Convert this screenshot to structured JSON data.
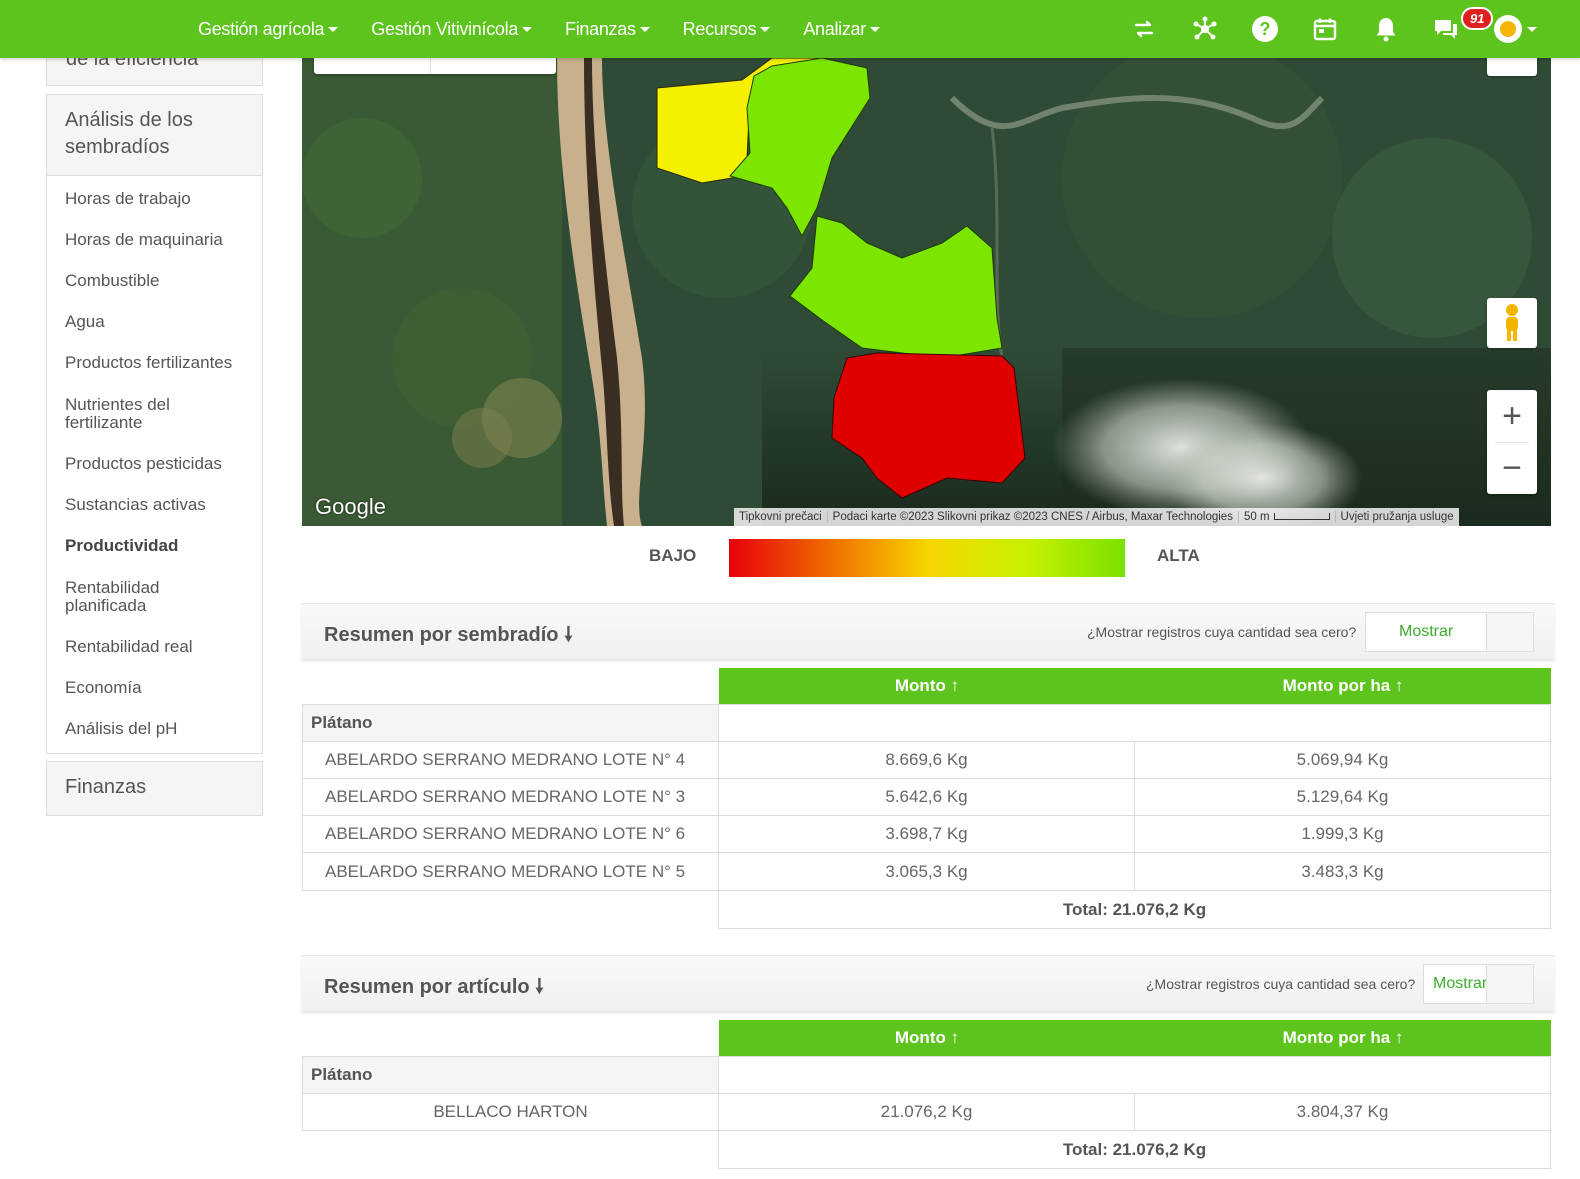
{
  "nav": {
    "menu": [
      "Gestión agrícola",
      "Gestión Vitivinícola",
      "Finanzas",
      "Recursos",
      "Analizar"
    ],
    "notifications_badge": "91",
    "icons": [
      "swap-icon",
      "network-icon",
      "help-icon",
      "calendar-icon",
      "bell-icon",
      "chat-icon"
    ]
  },
  "sidebar": {
    "top_partial": "de la eficiencia",
    "section_title": "Análisis de los sembradíos",
    "items": [
      "Horas de trabajo",
      "Horas de maquinaria",
      "Combustible",
      "Agua",
      "Productos fertilizantes",
      "Nutrientes del fertilizante",
      "Productos pesticidas",
      "Sustancias activas",
      "Productividad",
      "Rentabilidad planificada",
      "Rentabilidad real",
      "Economía",
      "Análisis del pH"
    ],
    "active_item": "Productividad",
    "finanzas": "Finanzas"
  },
  "map": {
    "google_logo": "Google",
    "attribution": [
      "Tipkovni prečaci",
      "Podaci karte ©2023 Slikovni prikaz ©2023 CNES / Airbus, Maxar Technologies",
      "50 m",
      "Uvjeti pružanja usluge"
    ],
    "zoom_in": "+",
    "zoom_out": "−"
  },
  "legend": {
    "low": "BAJO",
    "high": "ALTA",
    "low_color": "#e8000b",
    "high_color": "#7ae200"
  },
  "summary_field": {
    "title": "Resumen por sembradío",
    "zero_question": "¿Mostrar registros cuya cantidad sea cero?",
    "show_button": "Mostrar",
    "columns": [
      "Monto ↑",
      "Monto por ha ↑"
    ],
    "group": "Plátano",
    "rows": [
      {
        "name": "ABELARDO SERRANO MEDRANO LOTE N° 4",
        "monto": "8.669,6 Kg",
        "monto_ha": "5.069,94 Kg"
      },
      {
        "name": "ABELARDO SERRANO MEDRANO LOTE N° 3",
        "monto": "5.642,6 Kg",
        "monto_ha": "5.129,64 Kg"
      },
      {
        "name": "ABELARDO SERRANO MEDRANO LOTE N° 6",
        "monto": "3.698,7 Kg",
        "monto_ha": "1.999,3 Kg"
      },
      {
        "name": "ABELARDO SERRANO MEDRANO LOTE N° 5",
        "monto": "3.065,3 Kg",
        "monto_ha": "3.483,3 Kg"
      }
    ],
    "total": "Total: 21.076,2  Kg"
  },
  "summary_article": {
    "title": "Resumen por artículo",
    "zero_question": "¿Mostrar registros cuya cantidad sea cero?",
    "show_button": "Mostrar",
    "columns": [
      "Monto ↑",
      "Monto por ha ↑"
    ],
    "group": "Plátano",
    "rows": [
      {
        "name": "BELLACO HARTON",
        "monto": "21.076,2 Kg",
        "monto_ha": "3.804,37 Kg"
      }
    ],
    "total": "Total: 21.076,2  Kg"
  },
  "colors": {
    "brand_green": "#5cc41c",
    "field_yellow": "#f5f000",
    "field_green": "#7ce600",
    "field_red": "#e00000"
  }
}
